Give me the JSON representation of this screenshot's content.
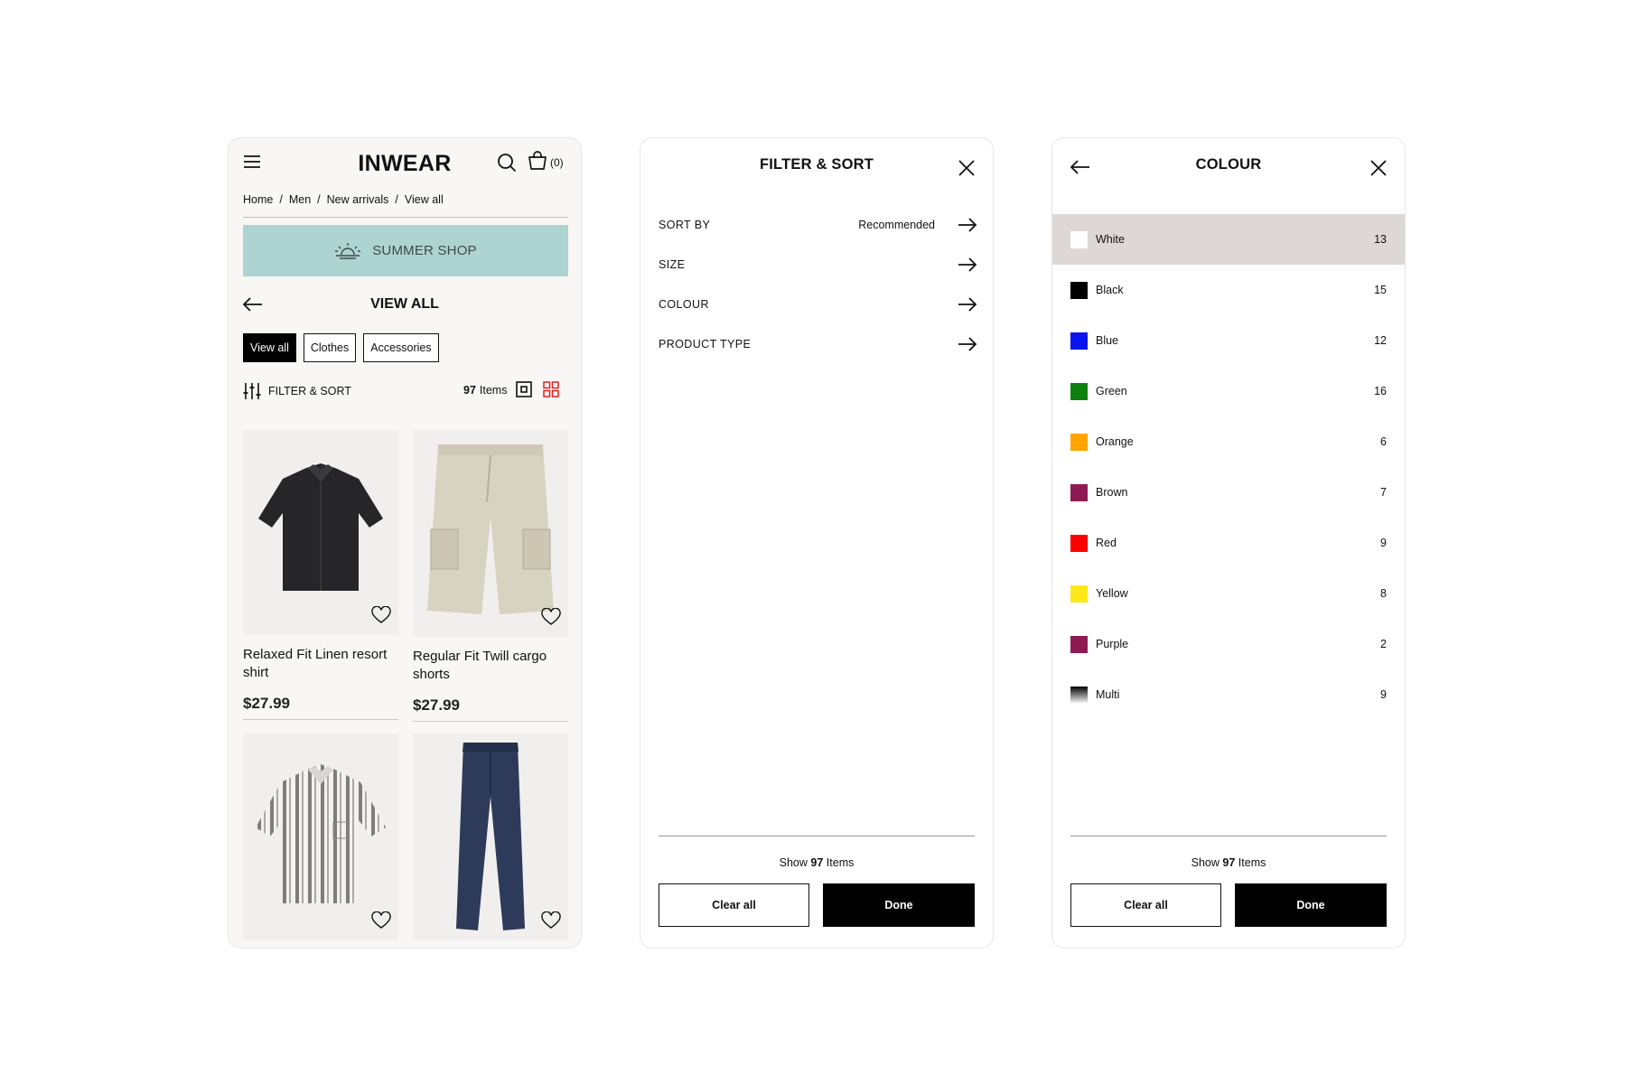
{
  "shop": {
    "brand": "INWEAR",
    "bag_count": "(0)",
    "breadcrumb": [
      "Home",
      "Men",
      "New arrivals",
      "View all"
    ],
    "breadcrumb_sep": "/",
    "banner": "SUMMER SHOP",
    "page_title": "VIEW ALL",
    "chips": [
      {
        "label": "View all",
        "active": true
      },
      {
        "label": "Clothes",
        "active": false
      },
      {
        "label": "Accessories",
        "active": false
      }
    ],
    "filter_label": "FILTER & SORT",
    "item_count": "97",
    "item_count_suffix": "Items",
    "products": [
      {
        "name": "Relaxed Fit Linen resort shirt",
        "price": "$27.99"
      },
      {
        "name": "Regular Fit Twill cargo shorts",
        "price": "$27.99"
      },
      {
        "name": "",
        "price": ""
      },
      {
        "name": "",
        "price": ""
      }
    ]
  },
  "filter_sheet": {
    "title": "FILTER & SORT",
    "options": [
      {
        "label": "SORT BY",
        "value": "Recommended"
      },
      {
        "label": "SIZE",
        "value": ""
      },
      {
        "label": "COLOUR",
        "value": ""
      },
      {
        "label": "PRODUCT TYPE",
        "value": ""
      }
    ],
    "show_prefix": "Show",
    "show_count": "97",
    "show_suffix": "Items",
    "clear_label": "Clear all",
    "done_label": "Done"
  },
  "colour_sheet": {
    "title": "COLOUR",
    "colours": [
      {
        "name": "White",
        "count": "13",
        "hex": "#ffffff",
        "selected": true
      },
      {
        "name": "Black",
        "count": "15",
        "hex": "#000000",
        "selected": false
      },
      {
        "name": "Blue",
        "count": "12",
        "hex": "#0a14f0",
        "selected": false
      },
      {
        "name": "Green",
        "count": "16",
        "hex": "#0e800e",
        "selected": false
      },
      {
        "name": "Orange",
        "count": "6",
        "hex": "#ffa400",
        "selected": false
      },
      {
        "name": "Brown",
        "count": "7",
        "hex": "#8e1a54",
        "selected": false
      },
      {
        "name": "Red",
        "count": "9",
        "hex": "#ff0000",
        "selected": false
      },
      {
        "name": "Yellow",
        "count": "8",
        "hex": "#ffe819",
        "selected": false
      },
      {
        "name": "Purple",
        "count": "2",
        "hex": "#8e1a54",
        "selected": false
      },
      {
        "name": "Multi",
        "count": "9",
        "hex": "multi",
        "selected": false
      }
    ],
    "show_prefix": "Show",
    "show_count": "97",
    "show_suffix": "Items",
    "clear_label": "Clear all",
    "done_label": "Done"
  },
  "colors": {
    "banner_bg": "#aed4d1",
    "grid_icon_accent": "#e02020",
    "selected_row_bg": "#ddd8d5"
  },
  "icons": [
    "menu-icon",
    "search-icon",
    "bag-icon",
    "sunset-icon",
    "arrow-left-icon",
    "filter-sliders-icon",
    "single-view-icon",
    "grid-view-icon",
    "heart-icon",
    "close-icon",
    "arrow-right-icon"
  ]
}
